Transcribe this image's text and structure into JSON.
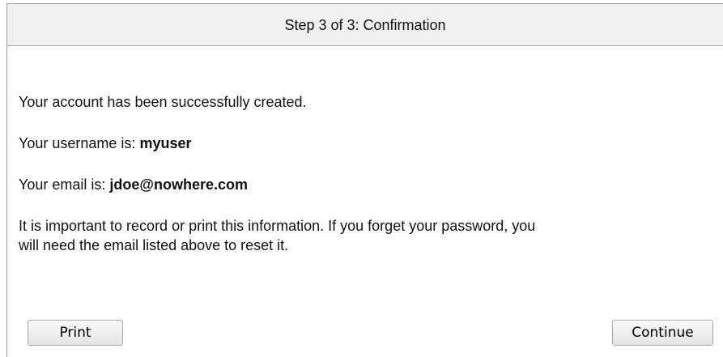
{
  "header": {
    "title": "Step 3 of 3: Confirmation"
  },
  "content": {
    "success_message": "Your account has been successfully created.",
    "username_label": "Your username is:",
    "username_value": "myuser",
    "email_label": "Your email is:",
    "email_value": "jdoe@nowhere.com",
    "notice_line_1": "It is important to record or print this information. If you forget your password, you",
    "notice_line_2": "will need the email listed above to reset it."
  },
  "buttons": {
    "print_label": "Print",
    "continue_label": "Continue"
  }
}
